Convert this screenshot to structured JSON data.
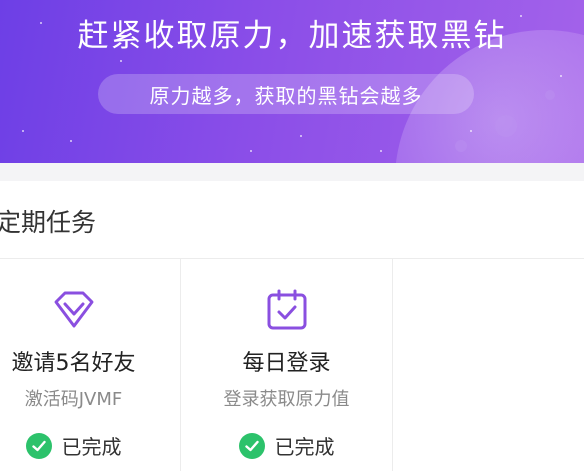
{
  "banner": {
    "title": "赶紧收取原力，加速获取黑钻",
    "subtitle": "原力越多，获取的黑钻会越多"
  },
  "section": {
    "title": "定期任务"
  },
  "tasks": [
    {
      "title": "邀请5名好友",
      "subtitle": "激活码JVMF",
      "status": "已完成",
      "icon": "diamond-icon"
    },
    {
      "title": "每日登录",
      "subtitle": "登录获取原力值",
      "status": "已完成",
      "icon": "calendar-check-icon"
    }
  ],
  "colors": {
    "banner_start": "#6d3fe6",
    "banner_end": "#a463ea",
    "icon_purple": "#8a4fe0",
    "done_green": "#2cc26b"
  }
}
